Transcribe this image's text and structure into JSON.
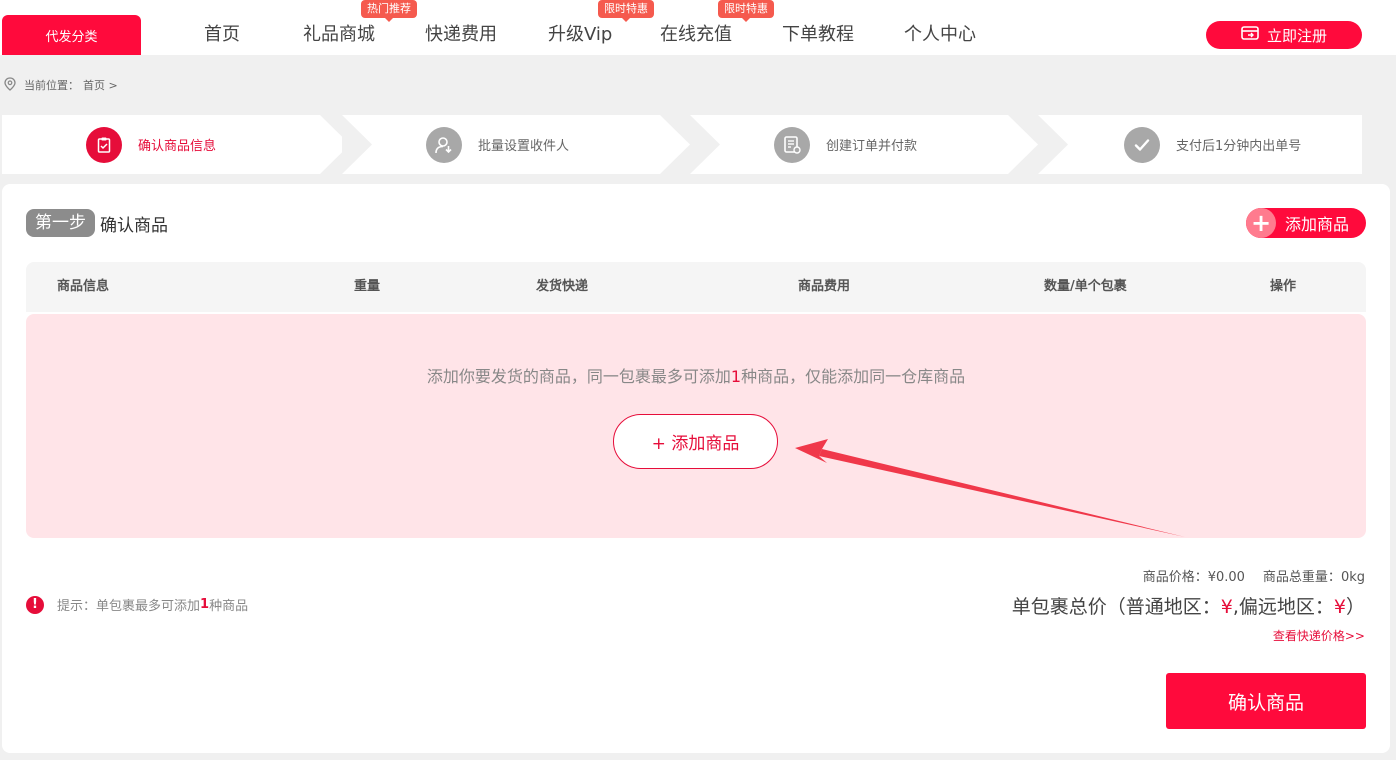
{
  "nav": {
    "category_button": "代发分类",
    "items": [
      {
        "label": "首页",
        "badge": ""
      },
      {
        "label": "礼品商城",
        "badge": "热门推荐"
      },
      {
        "label": "快递费用",
        "badge": ""
      },
      {
        "label": "升级Vip",
        "badge": "限时特惠"
      },
      {
        "label": "在线充值",
        "badge": "限时特惠"
      },
      {
        "label": "下单教程",
        "badge": ""
      },
      {
        "label": "个人中心",
        "badge": ""
      }
    ],
    "register_button": "立即注册"
  },
  "breadcrumb": {
    "icon": "location-pin-icon",
    "label": "当前位置：",
    "current": "首页 >"
  },
  "steps": [
    {
      "label": "确认商品信息",
      "icon": "clipboard-check-icon",
      "active": true
    },
    {
      "label": "批量设置收件人",
      "icon": "user-download-icon",
      "active": false
    },
    {
      "label": "创建订单并付款",
      "icon": "document-list-icon",
      "active": false
    },
    {
      "label": "支付后1分钟内出单号",
      "icon": "checkmark-icon",
      "active": false
    }
  ],
  "section": {
    "step_tag": "第一步",
    "title": "确认商品",
    "add_button": "添加商品"
  },
  "table": {
    "headers": [
      "商品信息",
      "重量",
      "发货快递",
      "商品费用",
      "数量/单个包裹",
      "操作"
    ]
  },
  "empty": {
    "text_before": "添加你要发货的商品，同一包裹最多可添加",
    "highlight": "1",
    "text_after": "种商品，仅能添加同一仓库商品",
    "add_button": "+ 添加商品"
  },
  "summary": {
    "price_label": "商品价格：",
    "price_value": "¥0.00",
    "weight_label": "商品总重量：",
    "weight_value": "0kg",
    "total_prefix": "单包裹总价（普通地区：",
    "yen1": "¥",
    "total_middle": ",偏远地区：",
    "yen2": "¥",
    "total_suffix": "）",
    "fee_link": "查看快递价格>>"
  },
  "tip": {
    "text_before": "提示：单包裹最多可添加",
    "highlight": "1",
    "text_after": "种商品"
  },
  "confirm_button": "确认商品",
  "colors": {
    "brand": "#ff0a3c",
    "badge": "#f55a4e",
    "empty_bg": "#ffe4e8"
  }
}
